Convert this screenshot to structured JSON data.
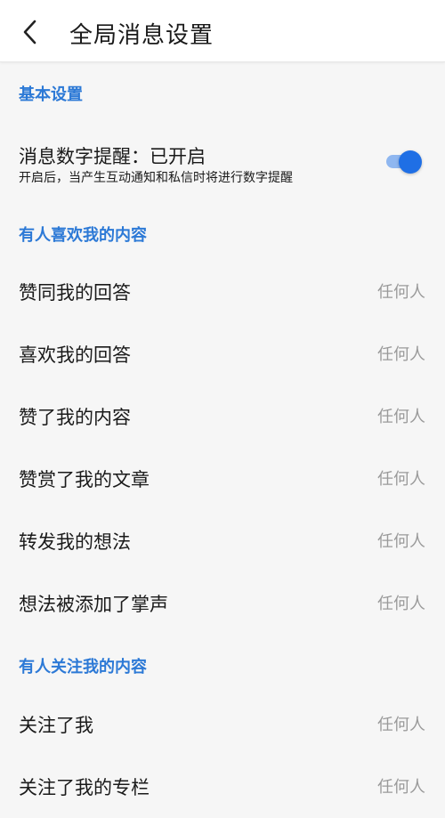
{
  "header": {
    "title": "全局消息设置",
    "back_icon": "chevron-left-icon"
  },
  "sections": {
    "basic": {
      "title": "基本设置",
      "toggle": {
        "title": "消息数字提醒：已开启",
        "subtitle": "开启后，当产生互动通知和私信时将进行数字提醒",
        "enabled": true,
        "accent_color": "#1f6fe5"
      }
    },
    "likes": {
      "title": "有人喜欢我的内容",
      "items": [
        {
          "label": "赞同我的回答",
          "value": "任何人"
        },
        {
          "label": "喜欢我的回答",
          "value": "任何人"
        },
        {
          "label": "赞了我的内容",
          "value": "任何人"
        },
        {
          "label": "赞赏了我的文章",
          "value": "任何人"
        },
        {
          "label": "转发我的想法",
          "value": "任何人"
        },
        {
          "label": "想法被添加了掌声",
          "value": "任何人"
        }
      ]
    },
    "follows": {
      "title": "有人关注我的内容",
      "items": [
        {
          "label": "关注了我",
          "value": "任何人"
        },
        {
          "label": "关注了我的专栏",
          "value": "任何人"
        }
      ]
    }
  }
}
